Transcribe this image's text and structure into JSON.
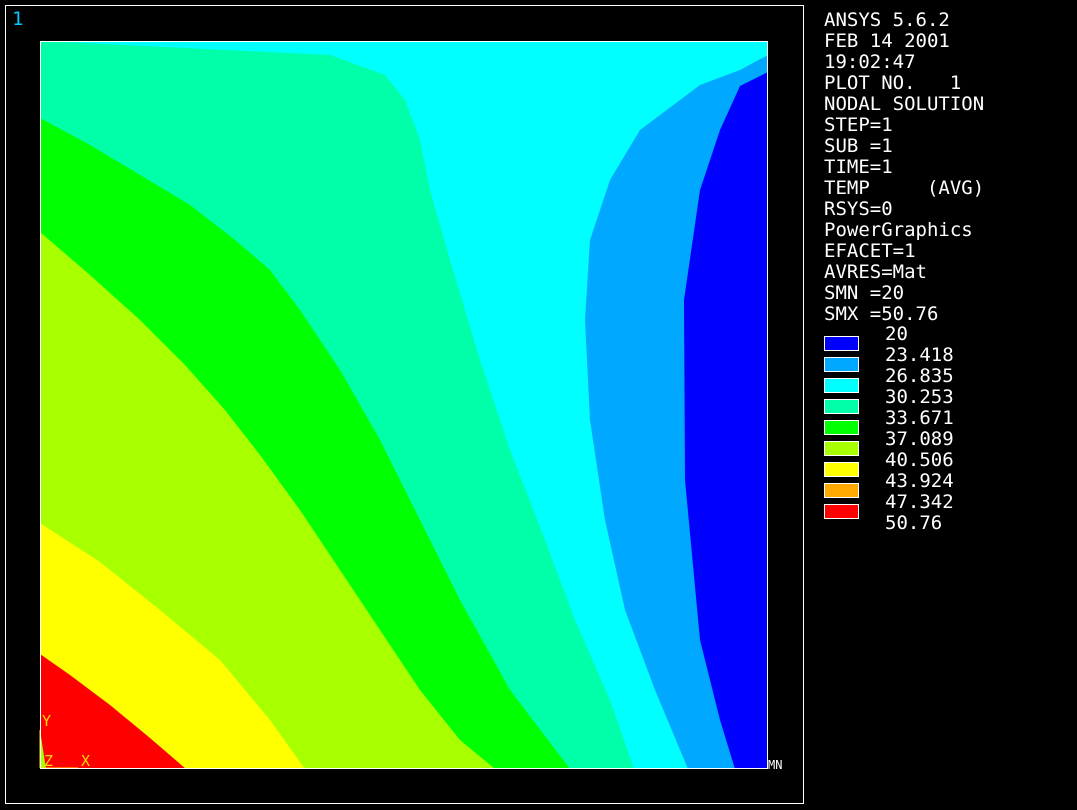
{
  "window": {
    "number": "1"
  },
  "info_lines": [
    "ANSYS 5.6.2",
    "FEB 14 2001",
    "19:02:47",
    "PLOT NO.   1",
    "NODAL SOLUTION",
    "STEP=1",
    "SUB =1",
    "TIME=1",
    "TEMP     (AVG)",
    "RSYS=0",
    "PowerGraphics",
    "EFACET=1",
    "AVRES=Mat",
    "SMN =20",
    "SMX =50.76"
  ],
  "legend": {
    "values": [
      "20",
      "23.418",
      "26.835",
      "30.253",
      "33.671",
      "37.089",
      "40.506",
      "43.924",
      "47.342",
      "50.76"
    ],
    "colors": [
      "#0000ff",
      "#00a8ff",
      "#00ffff",
      "#00ffa8",
      "#00ff00",
      "#a8ff00",
      "#ffff00",
      "#ffa800",
      "#ff0000"
    ]
  },
  "axes": {
    "y": "Y",
    "z": "Z",
    "x": "X",
    "triad_color": "#ffd700"
  },
  "markers": {
    "mn": "MN"
  },
  "colors": {
    "background": "#000000",
    "border": "#ffffff",
    "band_1": "#0000ff",
    "band_2": "#00a8ff",
    "band_3": "#00ffff",
    "band_4": "#00ffa8",
    "band_5": "#00ff00",
    "band_6": "#a8ff00",
    "band_7": "#ffff00",
    "band_9": "#ff0000"
  }
}
